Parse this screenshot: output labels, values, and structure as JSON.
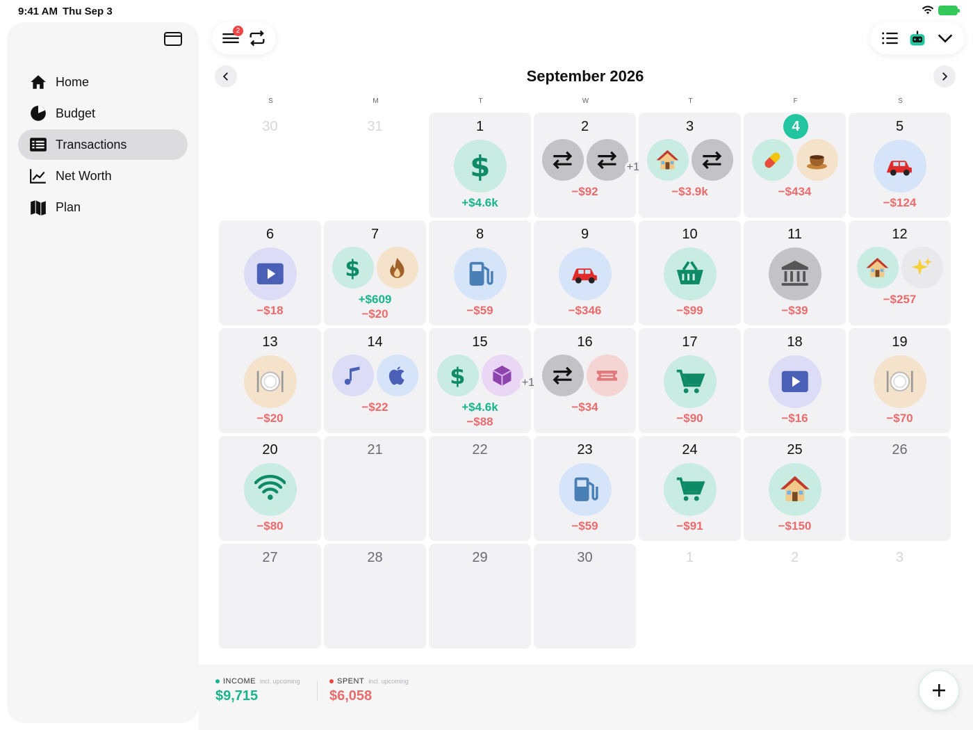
{
  "status": {
    "time": "9:41 AM",
    "date": "Thu Sep 3"
  },
  "sidebar": {
    "items": [
      {
        "label": "Home",
        "icon": "house-icon",
        "active": false
      },
      {
        "label": "Budget",
        "icon": "pie-chart-icon",
        "active": false
      },
      {
        "label": "Transactions",
        "icon": "list-icon",
        "active": true
      },
      {
        "label": "Net Worth",
        "icon": "line-chart-icon",
        "active": false
      },
      {
        "label": "Plan",
        "icon": "map-icon",
        "active": false
      }
    ]
  },
  "toolbar": {
    "notification_count": "2"
  },
  "month": {
    "title": "September 2026",
    "weekdays": [
      "S",
      "M",
      "T",
      "W",
      "T",
      "F",
      "S"
    ]
  },
  "colors": {
    "accent": "#22c59f",
    "negative": "#ea6b6b",
    "positive": "#18b58c",
    "teal_bg": "#c8ebe2",
    "gray_bg": "#c2c2c7",
    "blue_bg": "#d6e4fa",
    "peach_bg": "#f4e2ca",
    "lilac_bg": "#dcdcf6",
    "purple_bg": "#ead7f5",
    "pink_bg": "#f5d4d4",
    "light_bg": "#e9e9ec"
  },
  "days": [
    {
      "num": "30",
      "outside": true,
      "icons": [],
      "amounts": []
    },
    {
      "num": "31",
      "outside": true,
      "icons": [],
      "amounts": []
    },
    {
      "num": "1",
      "icons": [
        {
          "name": "dollar-icon",
          "bg": "#c8ebe2"
        }
      ],
      "amounts": [
        {
          "text": "+$4.6k",
          "type": "pos"
        }
      ]
    },
    {
      "num": "2",
      "icons": [
        {
          "name": "transfer-icon",
          "bg": "#c2c2c7"
        },
        {
          "name": "transfer-icon",
          "bg": "#c2c2c7"
        }
      ],
      "more": "+1",
      "amounts": [
        {
          "text": "−$92",
          "type": "neg"
        }
      ]
    },
    {
      "num": "3",
      "icons": [
        {
          "name": "house-icon",
          "bg": "#c8ebe2"
        },
        {
          "name": "transfer-icon",
          "bg": "#c2c2c7"
        }
      ],
      "amounts": [
        {
          "text": "−$3.9k",
          "type": "neg"
        }
      ]
    },
    {
      "num": "4",
      "today": true,
      "icons": [
        {
          "name": "pill-icon",
          "bg": "#c8ebe2"
        },
        {
          "name": "coffee-icon",
          "bg": "#f4e2ca"
        }
      ],
      "amounts": [
        {
          "text": "−$434",
          "type": "neg"
        }
      ]
    },
    {
      "num": "5",
      "icons": [
        {
          "name": "car-icon",
          "bg": "#d6e4fa"
        }
      ],
      "amounts": [
        {
          "text": "−$124",
          "type": "neg"
        }
      ]
    },
    {
      "num": "6",
      "icons": [
        {
          "name": "play-icon",
          "bg": "#dcdcf6"
        }
      ],
      "amounts": [
        {
          "text": "−$18",
          "type": "neg"
        }
      ]
    },
    {
      "num": "7",
      "icons": [
        {
          "name": "dollar-icon",
          "bg": "#c8ebe2"
        },
        {
          "name": "flame-icon",
          "bg": "#f4e2ca"
        }
      ],
      "amounts": [
        {
          "text": "+$609",
          "type": "pos"
        },
        {
          "text": "−$20",
          "type": "neg"
        }
      ]
    },
    {
      "num": "8",
      "icons": [
        {
          "name": "fuel-icon",
          "bg": "#d6e4fa"
        }
      ],
      "amounts": [
        {
          "text": "−$59",
          "type": "neg"
        }
      ]
    },
    {
      "num": "9",
      "icons": [
        {
          "name": "car-icon",
          "bg": "#d6e4fa"
        }
      ],
      "amounts": [
        {
          "text": "−$346",
          "type": "neg"
        }
      ]
    },
    {
      "num": "10",
      "icons": [
        {
          "name": "basket-icon",
          "bg": "#c8ebe2"
        }
      ],
      "amounts": [
        {
          "text": "−$99",
          "type": "neg"
        }
      ]
    },
    {
      "num": "11",
      "icons": [
        {
          "name": "bank-icon",
          "bg": "#c2c2c7"
        }
      ],
      "amounts": [
        {
          "text": "−$39",
          "type": "neg"
        }
      ]
    },
    {
      "num": "12",
      "icons": [
        {
          "name": "house-icon",
          "bg": "#c8ebe2"
        },
        {
          "name": "sparkles-icon",
          "bg": "#e9e9ec"
        }
      ],
      "amounts": [
        {
          "text": "−$257",
          "type": "neg"
        }
      ]
    },
    {
      "num": "13",
      "icons": [
        {
          "name": "dining-icon",
          "bg": "#f4e2ca"
        }
      ],
      "amounts": [
        {
          "text": "−$20",
          "type": "neg"
        }
      ]
    },
    {
      "num": "14",
      "icons": [
        {
          "name": "music-icon",
          "bg": "#dcdcf6"
        },
        {
          "name": "apple-icon",
          "bg": "#d6e4fa"
        }
      ],
      "amounts": [
        {
          "text": "−$22",
          "type": "neg"
        }
      ]
    },
    {
      "num": "15",
      "icons": [
        {
          "name": "dollar-icon",
          "bg": "#c8ebe2"
        },
        {
          "name": "box-icon",
          "bg": "#ead7f5"
        }
      ],
      "more": "+1",
      "amounts": [
        {
          "text": "+$4.6k",
          "type": "pos"
        },
        {
          "text": "−$88",
          "type": "neg"
        }
      ]
    },
    {
      "num": "16",
      "icons": [
        {
          "name": "transfer-icon",
          "bg": "#c2c2c7"
        },
        {
          "name": "ticket-icon",
          "bg": "#f5d4d4"
        }
      ],
      "amounts": [
        {
          "text": "−$34",
          "type": "neg"
        }
      ]
    },
    {
      "num": "17",
      "icons": [
        {
          "name": "cart-icon",
          "bg": "#c8ebe2"
        }
      ],
      "amounts": [
        {
          "text": "−$90",
          "type": "neg"
        }
      ]
    },
    {
      "num": "18",
      "icons": [
        {
          "name": "play-icon",
          "bg": "#dcdcf6"
        }
      ],
      "amounts": [
        {
          "text": "−$16",
          "type": "neg"
        }
      ]
    },
    {
      "num": "19",
      "icons": [
        {
          "name": "dining-icon",
          "bg": "#f4e2ca"
        }
      ],
      "amounts": [
        {
          "text": "−$70",
          "type": "neg"
        }
      ]
    },
    {
      "num": "20",
      "icons": [
        {
          "name": "wifi-icon",
          "bg": "#c8ebe2"
        }
      ],
      "amounts": [
        {
          "text": "−$80",
          "type": "neg"
        }
      ]
    },
    {
      "num": "21",
      "icons": [],
      "amounts": []
    },
    {
      "num": "22",
      "icons": [],
      "amounts": []
    },
    {
      "num": "23",
      "icons": [
        {
          "name": "fuel-icon",
          "bg": "#d6e4fa"
        }
      ],
      "amounts": [
        {
          "text": "−$59",
          "type": "neg"
        }
      ]
    },
    {
      "num": "24",
      "icons": [
        {
          "name": "cart-icon",
          "bg": "#c8ebe2"
        }
      ],
      "amounts": [
        {
          "text": "−$91",
          "type": "neg"
        }
      ]
    },
    {
      "num": "25",
      "icons": [
        {
          "name": "house-icon",
          "bg": "#c8ebe2"
        }
      ],
      "amounts": [
        {
          "text": "−$150",
          "type": "neg"
        }
      ]
    },
    {
      "num": "26",
      "icons": [],
      "amounts": []
    },
    {
      "num": "27",
      "icons": [],
      "amounts": []
    },
    {
      "num": "28",
      "icons": [],
      "amounts": []
    },
    {
      "num": "29",
      "icons": [],
      "amounts": []
    },
    {
      "num": "30",
      "icons": [],
      "amounts": []
    },
    {
      "num": "1",
      "outside": true,
      "icons": [],
      "amounts": []
    },
    {
      "num": "2",
      "outside": true,
      "icons": [],
      "amounts": []
    },
    {
      "num": "3",
      "outside": true,
      "icons": [],
      "amounts": []
    }
  ],
  "footer": {
    "income": {
      "label": "INCOME",
      "sub": "incl. upcoming",
      "value": "$9,715",
      "color": "#18b58c"
    },
    "spent": {
      "label": "SPENT",
      "sub": "incl. upcoming",
      "value": "$6,058",
      "color": "#ea6b6b"
    }
  }
}
